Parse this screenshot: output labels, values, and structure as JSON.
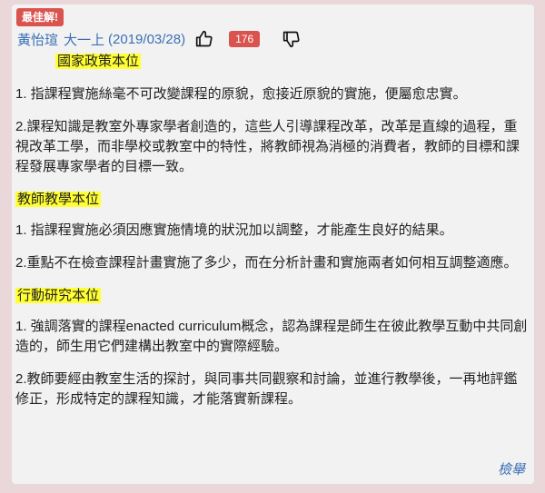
{
  "badge": "最佳解!",
  "header": {
    "author": "黃怡瑄",
    "grade": "大一上",
    "date": "(2019/03/28)",
    "like_count": "176"
  },
  "icons": {
    "like": "thumbs-up-icon",
    "dislike": "thumbs-down-icon"
  },
  "content": {
    "section1": {
      "title": "國家政策本位",
      "p1": "1. 指課程實施絲毫不可改變課程的原貌，愈接近原貌的實施，便屬愈忠實。",
      "p2": "2.課程知識是教室外專家學者創造的，這些人引導課程改革，改革是直線的過程，重視改革工學，而非學校或教室中的特性，將教師視為消極的消費者，教師的目標和課程發展專家學者的目標一致。"
    },
    "section2": {
      "title": "教師教學本位",
      "p1": "1. 指課程實施必須因應實施情境的狀況加以調整，才能產生良好的結果。",
      "p2": "2.重點不在檢查課程計畫實施了多少，而在分析計畫和實施兩者如何相互調整適應。"
    },
    "section3": {
      "title": "行動研究本位",
      "p1": "1. 強調落實的課程enacted curriculum概念，認為課程是師生在彼此教學互動中共同創造的，師生用它們建構出教室中的實際經驗。",
      "p2": "2.教師要經由教室生活的探討，與同事共同觀察和討論，並進行教學後，一再地評鑑修正，形成特定的課程知識，才能落實新課程。"
    }
  },
  "footer": {
    "report_label": "檢舉"
  },
  "colors": {
    "badge": "#d9534f",
    "link": "#3b6fb6",
    "highlight": "#ffff33",
    "background": "#ead7da"
  }
}
